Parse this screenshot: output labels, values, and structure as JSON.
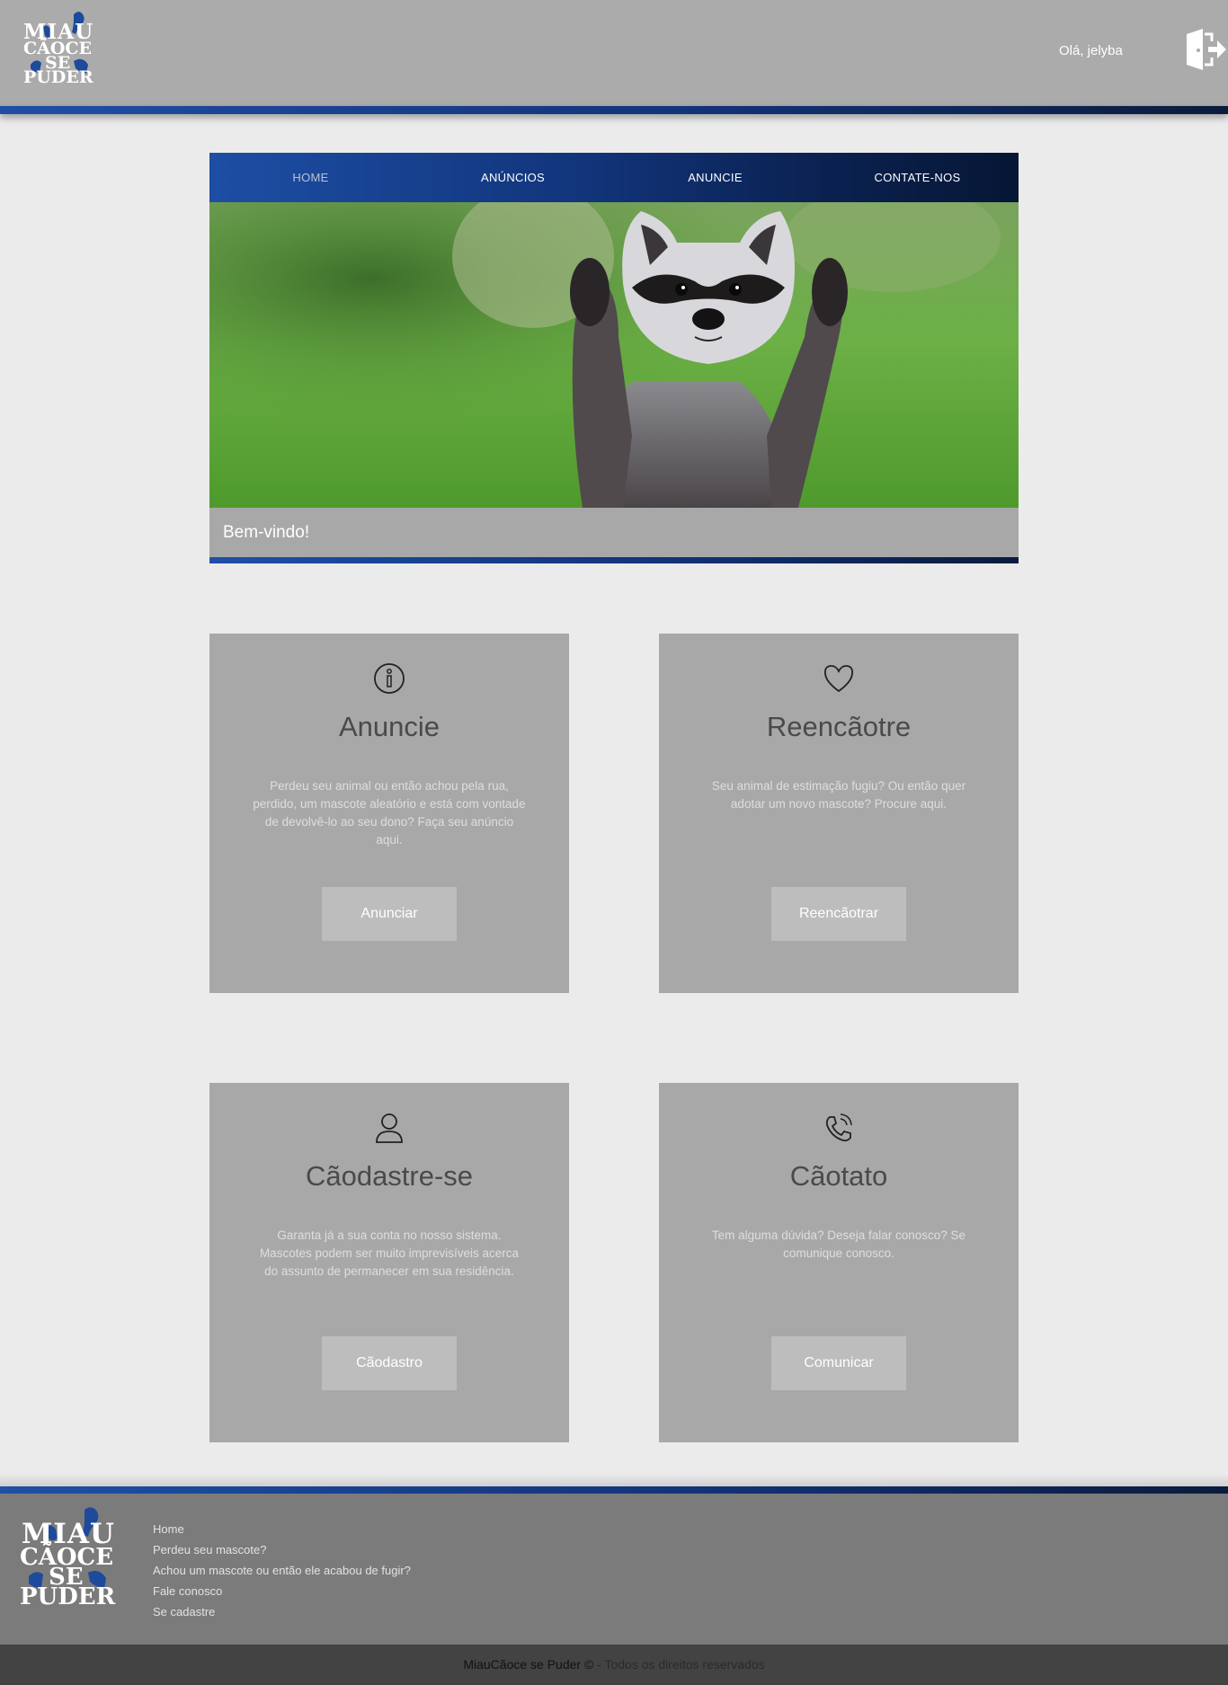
{
  "header": {
    "logo": {
      "line1": "MIAU",
      "line2": "CÃOCE",
      "line3": "SE",
      "line4": "PUDER"
    },
    "greeting": "Olá, jelyba",
    "logout_icon": "door-exit-icon"
  },
  "nav": {
    "items": [
      {
        "label": "HOME",
        "active": true
      },
      {
        "label": "ANÚNCIOS",
        "active": false
      },
      {
        "label": "ANUNCIE",
        "active": false
      },
      {
        "label": "CONTATE-NOS",
        "active": false
      }
    ]
  },
  "hero": {
    "image": "raccoon-photo",
    "caption": "Bem-vindo!"
  },
  "cards": [
    {
      "icon": "info-icon",
      "title": "Anuncie",
      "text": "Perdeu seu animal ou então achou pela rua, perdido, um mascote aleatório e está com vontade de devolvê-lo ao seu dono? Faça seu anúncio aqui.",
      "button": "Anunciar"
    },
    {
      "icon": "heart-icon",
      "title": "Reencãotre",
      "text": "Seu animal de estimação fugiu? Ou então quer adotar um novo mascote? Procure aqui.",
      "button": "Reencãotrar"
    },
    {
      "icon": "user-icon",
      "title": "Cãodastre-se",
      "text": "Garanta já a sua conta no nosso sistema. Mascotes podem ser muito imprevisíveis acerca do assunto de permanecer em sua residência.",
      "button": "Cãodastro"
    },
    {
      "icon": "phone-icon",
      "title": "Cãotato",
      "text": "Tem alguma dúvida? Deseja falar conosco? Se comunique conosco.",
      "button": "Comunicar"
    }
  ],
  "footer": {
    "logo": {
      "line1": "MIAU",
      "line2": "CÃOCE",
      "line3": "SE",
      "line4": "PUDER"
    },
    "links": [
      "Home",
      "Perdeu seu mascote?",
      "Achou um mascote ou então ele acabou de fugir?",
      "Fale conosco",
      "Se cadastre"
    ],
    "copyright_brand": "MiauCãoce se Puder ©",
    "copyright_rest": " - Todos os direitos reservados"
  },
  "colors": {
    "header_bg": "#ababab",
    "accent_blue": "#1f4fa6",
    "accent_navy": "#0a1b3d",
    "card_bg": "#a8a8a8",
    "footer_bg": "#7b7b7b",
    "copyright_bg": "#434343"
  }
}
